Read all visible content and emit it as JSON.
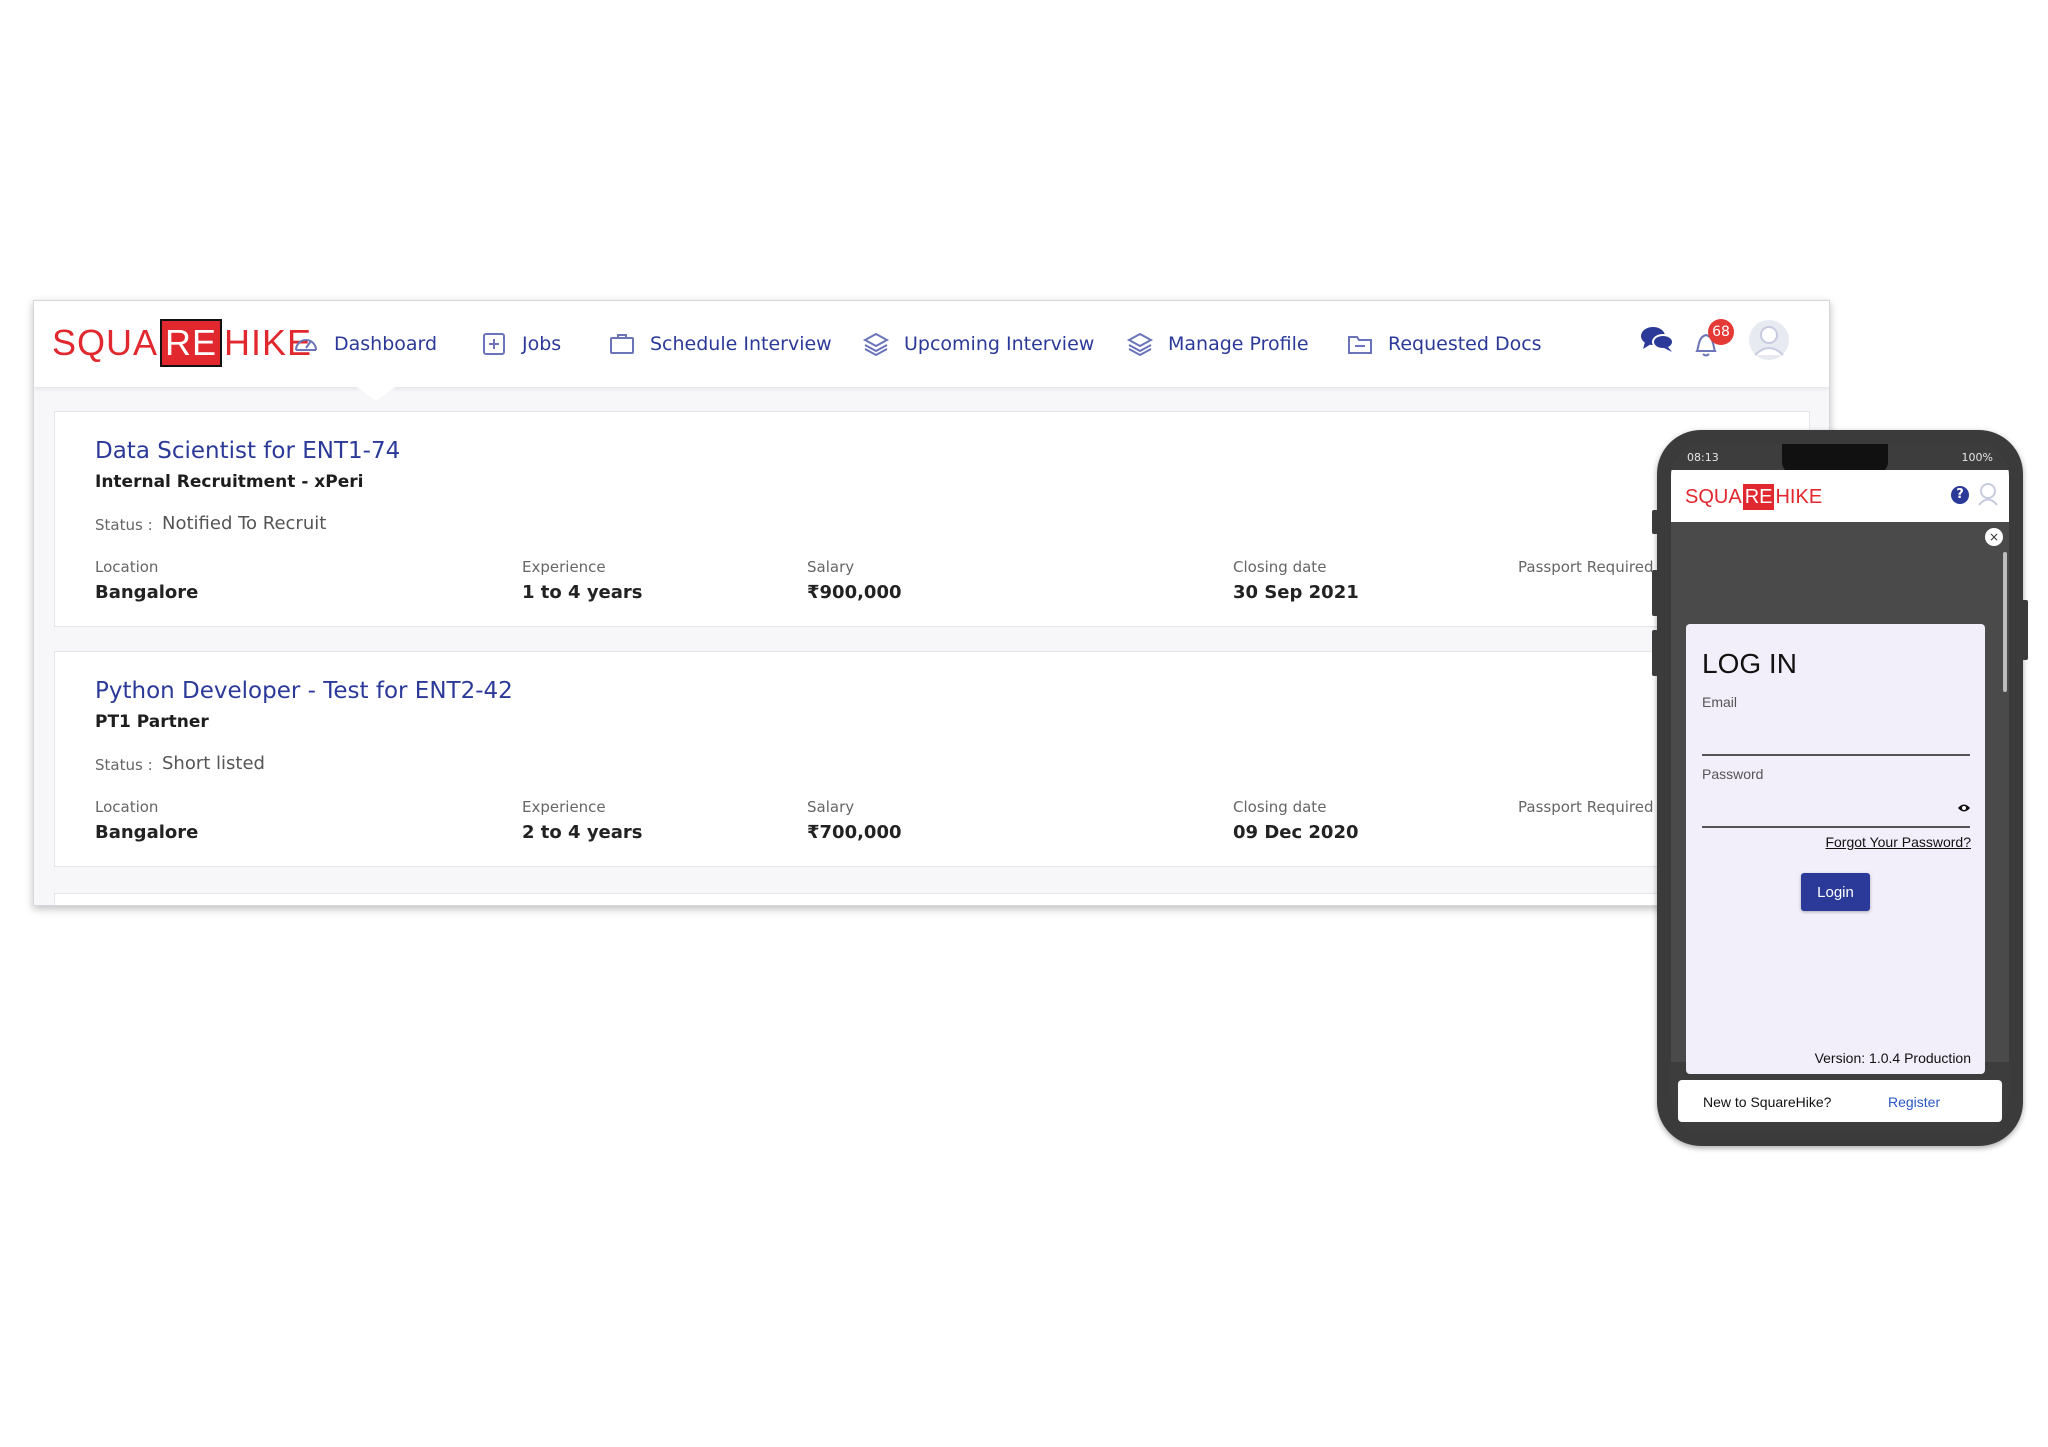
{
  "brand": {
    "logo_left": "SQUA",
    "logo_mid": "RE",
    "logo_right": "HIKE",
    "accent": "#e0282e",
    "nav_color": "#2b3a98"
  },
  "nav": [
    {
      "label": "Dashboard",
      "icon": "dashboard-gauge-icon"
    },
    {
      "label": "Jobs",
      "icon": "jobs-plus-icon"
    },
    {
      "label": "Schedule Interview",
      "icon": "briefcase-icon"
    },
    {
      "label": "Upcoming Interview",
      "icon": "layers-icon"
    },
    {
      "label": "Manage Profile",
      "icon": "layers-icon"
    },
    {
      "label": "Requested Docs",
      "icon": "folder-icon"
    }
  ],
  "header_icons": {
    "chat": "chat-bubbles-icon",
    "notifications": "bell-icon",
    "notification_count": "68",
    "avatar": "user-avatar-icon"
  },
  "jobs": [
    {
      "title": "Data Scientist for ENT1-74",
      "company": "Internal Recruitment - xPeri",
      "status_label": "Status :",
      "status": "Notified To Recruit",
      "location_label": "Location",
      "location": "Bangalore",
      "experience_label": "Experience",
      "experience": "1 to 4 years",
      "salary_label": "Salary",
      "salary": "₹900,000",
      "closing_label": "Closing date",
      "closing": "30 Sep 2021",
      "passport_label": "Passport Required"
    },
    {
      "title": "Python Developer - Test for ENT2-42",
      "company": "PT1 Partner",
      "status_label": "Status :",
      "status": "Short listed",
      "location_label": "Location",
      "location": "Bangalore",
      "experience_label": "Experience",
      "experience": "2 to 4 years",
      "salary_label": "Salary",
      "salary": "₹700,000",
      "closing_label": "Closing date",
      "closing": "09 Dec 2020",
      "passport_label": "Passport Required"
    }
  ],
  "mobile": {
    "status_time": "08:13",
    "status_right": "100%",
    "logo_left": "SQUA",
    "logo_mid": "RE",
    "logo_right": "HIKE",
    "help": "?",
    "close": "×",
    "login_title": "LOG IN",
    "email_label": "Email",
    "email_value": "",
    "password_label": "Password",
    "password_value": "",
    "forgot": "Forgot Your Password?",
    "login_button": "Login",
    "version": "Version: 1.0.4 Production",
    "register_question": "New to SquareHike?",
    "register_link": "Register"
  }
}
